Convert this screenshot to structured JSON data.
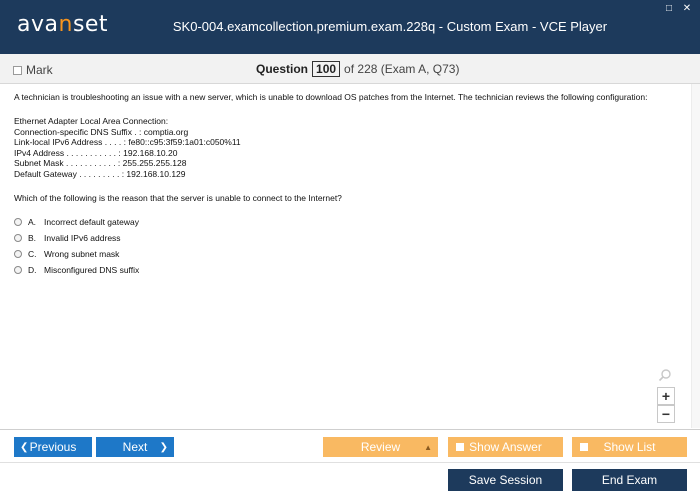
{
  "app": {
    "logo_text_before": "ava",
    "logo_text_accent": "n",
    "logo_text_after": "set",
    "window_title": "SK0-004.examcollection.premium.exam.228q - Custom Exam - VCE Player",
    "accent_color": "#f7941d",
    "titlebar_color": "#1d3a5c"
  },
  "window_controls": {
    "restore": "□",
    "close": "✕"
  },
  "header": {
    "mark_label": "Mark",
    "question_word": "Question",
    "question_number": "100",
    "question_total": "of 228 (Exam A, Q73)"
  },
  "question": {
    "intro": "A technician is troubleshooting an issue with a new server, which is unable to download OS patches from the Internet. The technician reviews the following configuration:",
    "config_lines": [
      "Ethernet Adapter Local Area Connection:",
      "Connection-specific DNS Suffix . : comptia.org",
      "Link-local IPv6 Address . . . . : fe80::c95:3f59:1a01:c050%11",
      "IPv4 Address . . . . . . . . . . . : 192.168.10.20",
      "Subnet Mask . . . . . . . . . . . : 255.255.255.128",
      "Default Gateway . . . . . . . . . : 192.168.10.129"
    ],
    "prompt": "Which of the following is the reason that the server is unable to connect to the Internet?",
    "options": [
      {
        "letter": "A.",
        "text": "Incorrect default gateway"
      },
      {
        "letter": "B.",
        "text": "Invalid IPv6 address"
      },
      {
        "letter": "C.",
        "text": "Wrong subnet mask"
      },
      {
        "letter": "D.",
        "text": "Misconfigured DNS suffix"
      }
    ]
  },
  "zoom": {
    "plus": "+",
    "minus": "−"
  },
  "nav": {
    "previous": "Previous",
    "next": "Next",
    "review": "Review",
    "show_answer": "Show Answer",
    "show_list": "Show List",
    "save_session": "Save Session",
    "end_exam": "End Exam"
  }
}
